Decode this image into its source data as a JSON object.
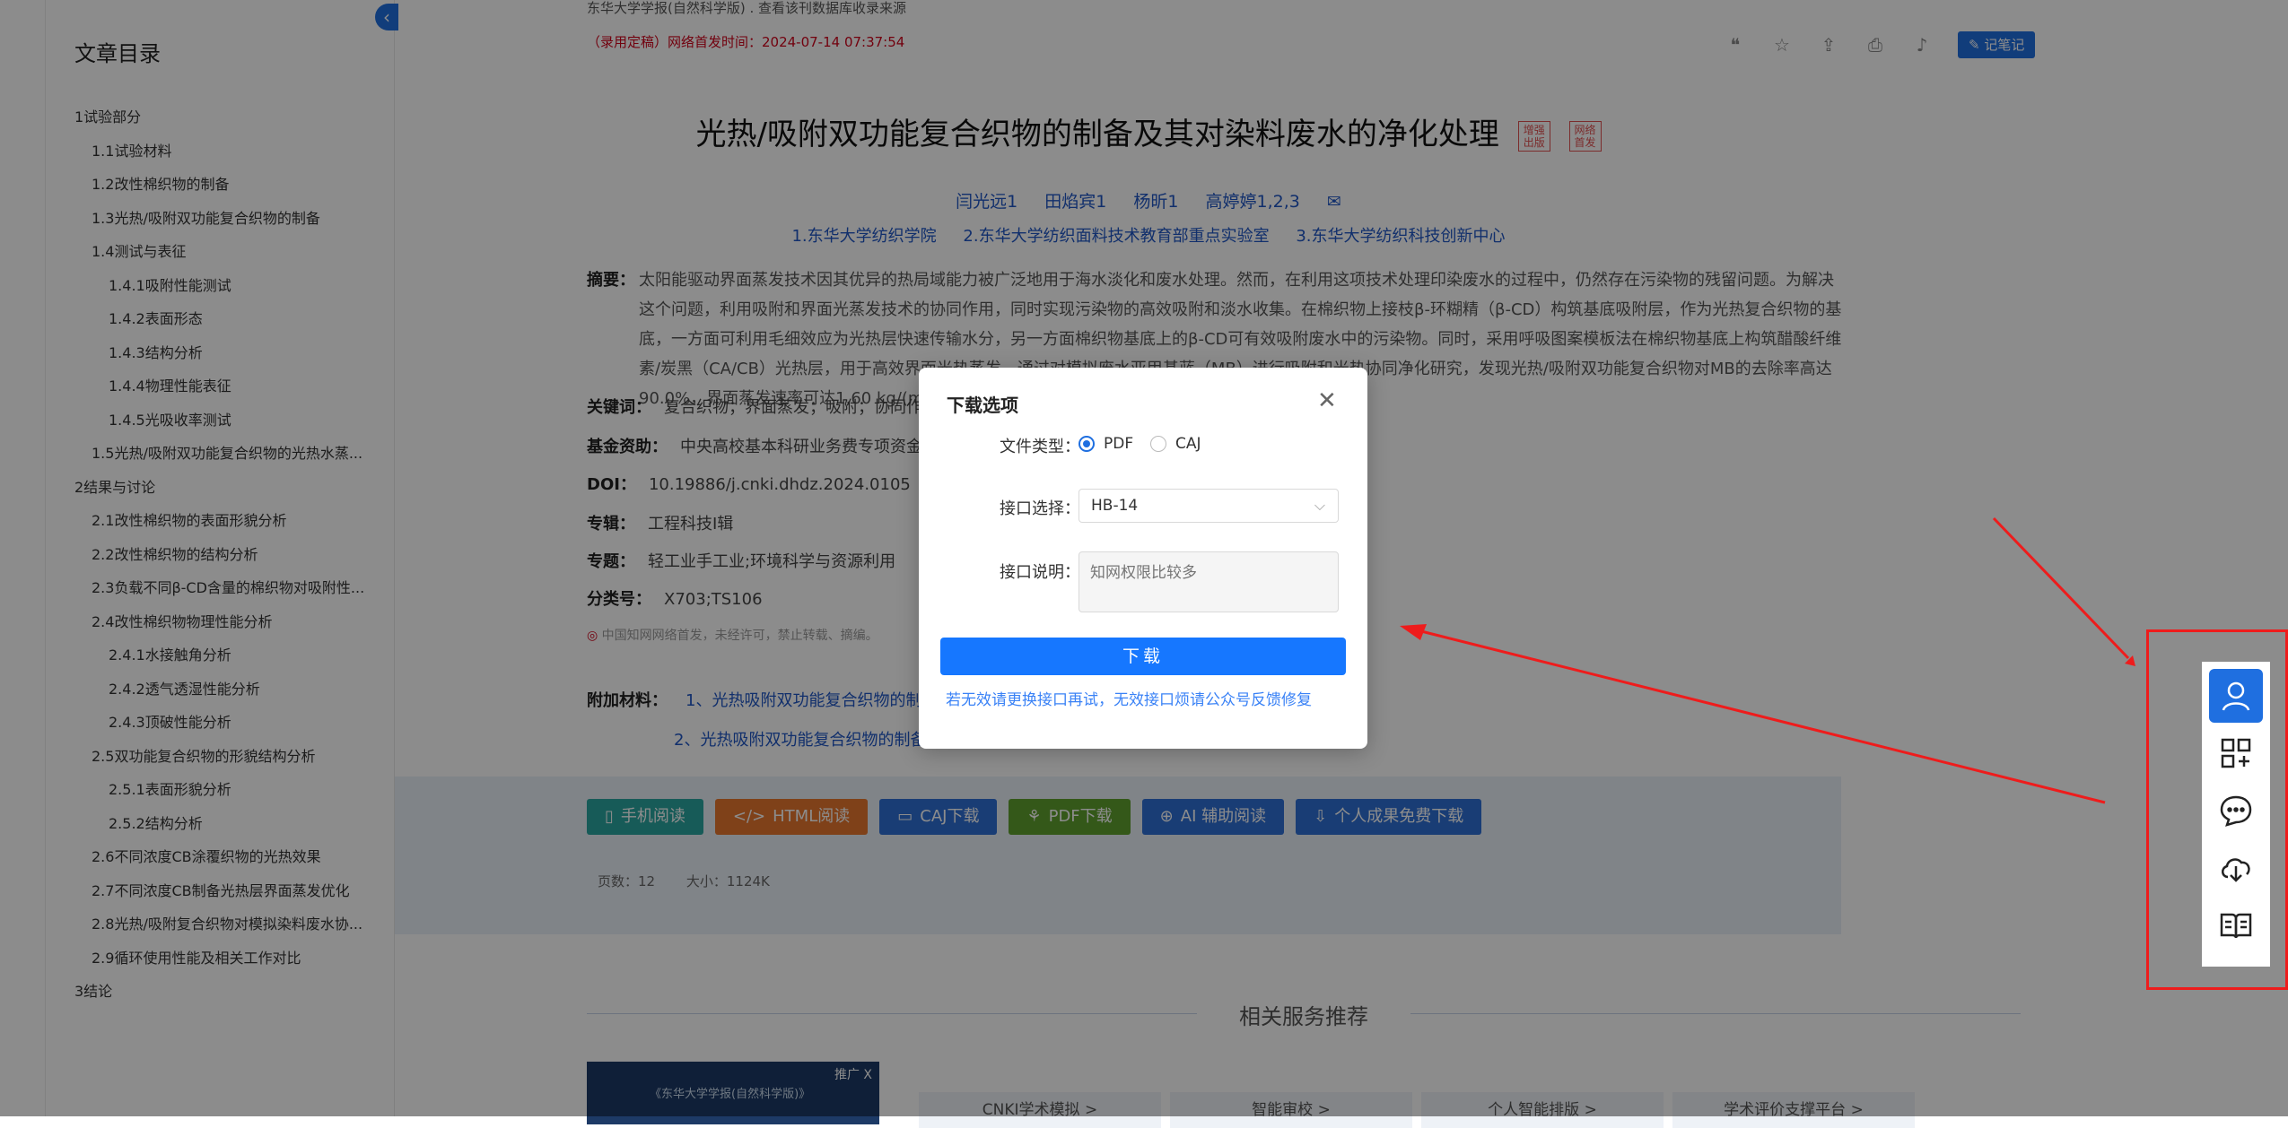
{
  "sidebar": {
    "title": "文章目录",
    "items": [
      {
        "label": "1试验部分",
        "level": 1
      },
      {
        "label": "1.1试验材料",
        "level": 2
      },
      {
        "label": "1.2改性棉织物的制备",
        "level": 2
      },
      {
        "label": "1.3光热/吸附双功能复合织物的制备",
        "level": 2
      },
      {
        "label": "1.4测试与表征",
        "level": 2
      },
      {
        "label": "1.4.1吸附性能测试",
        "level": 3
      },
      {
        "label": "1.4.2表面形态",
        "level": 3
      },
      {
        "label": "1.4.3结构分析",
        "level": 3
      },
      {
        "label": "1.4.4物理性能表征",
        "level": 3
      },
      {
        "label": "1.4.5光吸收率测试",
        "level": 3
      },
      {
        "label": "1.5光热/吸附双功能复合织物的光热水蒸...",
        "level": 2
      },
      {
        "label": "2结果与讨论",
        "level": 1
      },
      {
        "label": "2.1改性棉织物的表面形貌分析",
        "level": 2
      },
      {
        "label": "2.2改性棉织物的结构分析",
        "level": 2
      },
      {
        "label": "2.3负载不同β-CD含量的棉织物对吸附性...",
        "level": 2
      },
      {
        "label": "2.4改性棉织物物理性能分析",
        "level": 2
      },
      {
        "label": "2.4.1水接触角分析",
        "level": 3
      },
      {
        "label": "2.4.2透气透湿性能分析",
        "level": 3
      },
      {
        "label": "2.4.3顶破性能分析",
        "level": 3
      },
      {
        "label": "2.5双功能复合织物的形貌结构分析",
        "level": 2
      },
      {
        "label": "2.5.1表面形貌分析",
        "level": 3
      },
      {
        "label": "2.5.2结构分析",
        "level": 3
      },
      {
        "label": "2.6不同浓度CB涂覆织物的光热效果",
        "level": 2
      },
      {
        "label": "2.7不同浓度CB制备光热层界面蒸发优化",
        "level": 2
      },
      {
        "label": "2.8光热/吸附复合织物对模拟染料废水协...",
        "level": 2
      },
      {
        "label": "2.9循环使用性能及相关工作对比",
        "level": 2
      },
      {
        "label": "3结论",
        "level": 1
      }
    ]
  },
  "header": {
    "source": "东华大学学报(自然科学版)  .  查看该刊数据库收录来源",
    "pubtime": "（录用定稿）网络首发时间：2024-07-14 07:37:54",
    "note_label": "记笔记"
  },
  "article": {
    "title": "光热/吸附双功能复合织物的制备及其对染料废水的净化处理",
    "badge1": "增强出版",
    "badge2": "网络首发",
    "authors": [
      "闫光远1",
      "田焰宾1",
      "杨昕1",
      "高婷婷1,2,3"
    ],
    "orgs": [
      "1.东华大学纺织学院",
      "2.东华大学纺织面料技术教育部重点实验室",
      "3.东华大学纺织科技创新中心"
    ],
    "abstract_label": "摘要：",
    "abstract": "太阳能驱动界面蒸发技术因其优异的热局域能力被广泛地用于海水淡化和废水处理。然而，在利用这项技术处理印染废水的过程中，仍然存在污染物的残留问题。为解决这个问题，利用吸附和界面光蒸发技术的协同作用，同时实现污染物的高效吸附和淡水收集。在棉织物上接枝β-环糊精（β-CD）构筑基底吸附层，作为光热复合织物的基底，一方面可利用毛细效应为光热层快速传输水分，另一方面棉织物基底上的β-CD可有效吸附废水中的污染物。同时，采用呼吸图案模板法在棉织物基底上构筑醋酸纤维素/炭黑（CA/CB）光热层，用于高效界面光热蒸发。通过对模拟废水亚甲基蓝（MB）进行吸附和光热协同净化研究，发现光热/吸附双功能复合织物对MB的去除率高达90.0%，界面蒸发速率可达1.60 kg/(m²·h)，体现出优异水净化效果。",
    "keywords_label": "关键词：",
    "keywords": "复合织物；界面蒸发；吸附；协同作用",
    "fund_label": "基金资助：",
    "fund": "中央高校基本科研业务费专项资金资助",
    "doi_label": "DOI：",
    "doi": "10.19886/j.cnki.dhdz.2024.0105",
    "series_label": "专辑：",
    "series": "工程科技Ⅰ辑",
    "topic_label": "专题：",
    "topic": "轻工业手工业;环境科学与资源利用",
    "class_label": "分类号：",
    "class": "X703;TS106",
    "notice": "中国知网网络首发，未经许可，禁止转载、摘编。",
    "attach_label": "附加材料：",
    "attach1": "1、光热吸附双功能复合织物的制备",
    "attach2": "2、光热吸附双功能复合织物的制备"
  },
  "download_bar": {
    "buttons": [
      {
        "label": "手机阅读",
        "color": "#2aa7a0"
      },
      {
        "label": "HTML阅读",
        "color": "#e8772e"
      },
      {
        "label": "CAJ下载",
        "color": "#2e6fd6"
      },
      {
        "label": "PDF下载",
        "color": "#5fa12f"
      },
      {
        "label": "AI 辅助阅读",
        "color": "#2e6fd6"
      },
      {
        "label": "个人成果免费下载",
        "color": "#2e6fd6"
      }
    ],
    "pages": "页数：12",
    "size": "大小：1124K"
  },
  "related": {
    "title": "相关服务推荐",
    "promo_tag": "推广 X",
    "promo_caption": "《东华大学学报(自然科学版)》",
    "services": [
      "CNKI学术模拟 >",
      "智能审校 >",
      "个人智能排版 >",
      "学术评价支撑平台 >"
    ]
  },
  "modal": {
    "title": "下载选项",
    "file_type_label": "文件类型：",
    "option_pdf": "PDF",
    "option_caj": "CAJ",
    "selected": "PDF",
    "interface_label": "接口选择：",
    "interface_value": "HB-14",
    "desc_label": "接口说明：",
    "desc_placeholder": "知网权限比较多",
    "download_label": "下载",
    "hint": "若无效请更换接口再试，无效接口烦请公众号反馈修复"
  },
  "dock": {
    "icons": [
      "user-icon",
      "apps-icon",
      "chat-icon",
      "cloud-download-icon",
      "book-icon"
    ]
  },
  "annotation_color": "#ee1c1c"
}
